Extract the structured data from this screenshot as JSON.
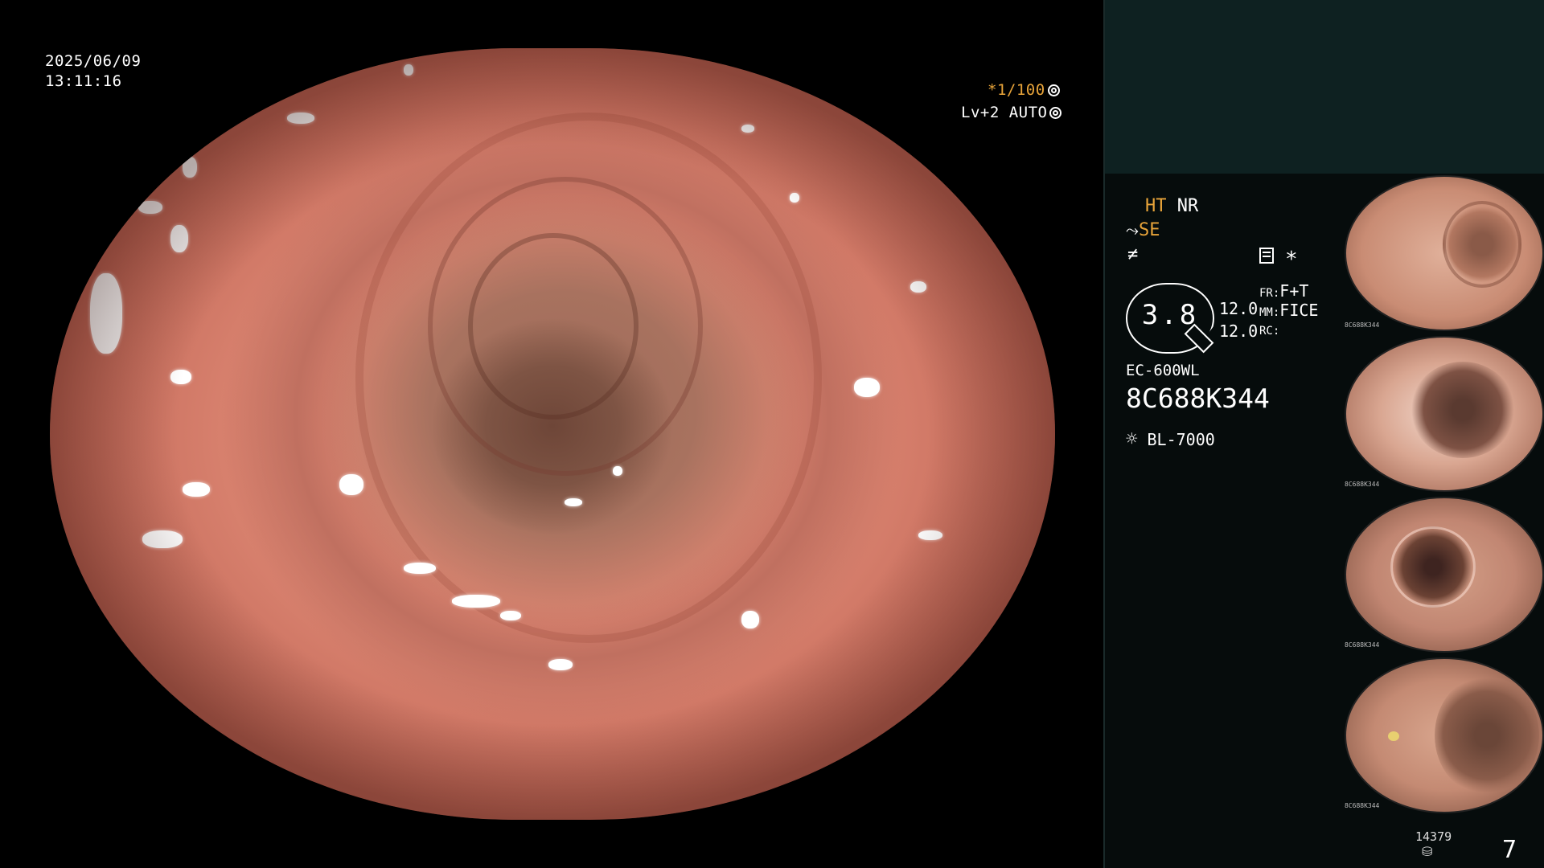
{
  "datetime": {
    "date": "2025/06/09",
    "time": "13:11:16"
  },
  "scope_overlay": {
    "shutter": "*1/100",
    "shutter_icon": "aperture-icon",
    "level": "Lv+2",
    "mode": "AUTO",
    "mode_icon": "settings-ring-icon"
  },
  "info": {
    "ht": "HT",
    "nr": "NR",
    "se": "SE",
    "se_icon": "structure-enhance-icon",
    "f_icon": "filter-icon",
    "asterisk": "*",
    "storage_icon": "storage-icon",
    "zoom_value": "3.8",
    "value_1": "12.0",
    "value_2": "12.0",
    "fr_label": "FR:",
    "fr_value": "F+T",
    "mm_label": "MM:",
    "mm_value": "FICE",
    "rc_label": "RC:",
    "rc_value": "",
    "scope_model": "EC-600WL",
    "serial": "8C688K344",
    "light_icon": "light-source-icon",
    "light_source": "BL-7000"
  },
  "thumbnail_tag": "8C688K344",
  "counter": "14379",
  "counter_icon": "disk-icon",
  "page_number": "7",
  "colors": {
    "panel_top": "#0e2121",
    "panel": "#060c0c",
    "amber": "#e8a43a",
    "mucosa": "#e48d78"
  }
}
